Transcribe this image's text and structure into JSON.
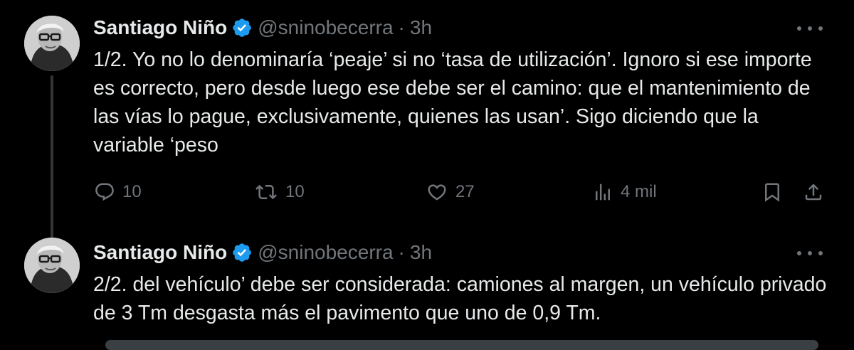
{
  "tweets": [
    {
      "author_name": "Santiago Niño",
      "handle": "@sninobecerra",
      "separator": "·",
      "time": "3h",
      "text": "1/2. Yo no lo denominaría ‘peaje’ si no ‘tasa de utilización’. Ignoro si ese importe es correcto, pero desde luego ese debe ser el camino: que el mantenimiento de las vías lo pague, exclusivamente, quienes las usan’. Sigo diciendo que la variable ‘peso",
      "actions": {
        "replies": "10",
        "retweets": "10",
        "likes": "27",
        "views": "4 mil"
      }
    },
    {
      "author_name": "Santiago Niño",
      "handle": "@sninobecerra",
      "separator": "·",
      "time": "3h",
      "text": "2/2. del vehículo’ debe ser considerada: camiones al margen, un vehículo privado de 3 Tm desgasta más el pavimento que uno de 0,9 Tm."
    }
  ],
  "icons": {
    "verified": "verified-badge-icon",
    "more": "more-icon",
    "reply": "reply-icon",
    "retweet": "retweet-icon",
    "like": "heart-icon",
    "views": "views-icon",
    "bookmark": "bookmark-icon",
    "share": "share-icon"
  },
  "colors": {
    "background": "#000000",
    "text": "#e7e9ea",
    "secondary": "#71767b",
    "verified": "#1d9bf0"
  }
}
